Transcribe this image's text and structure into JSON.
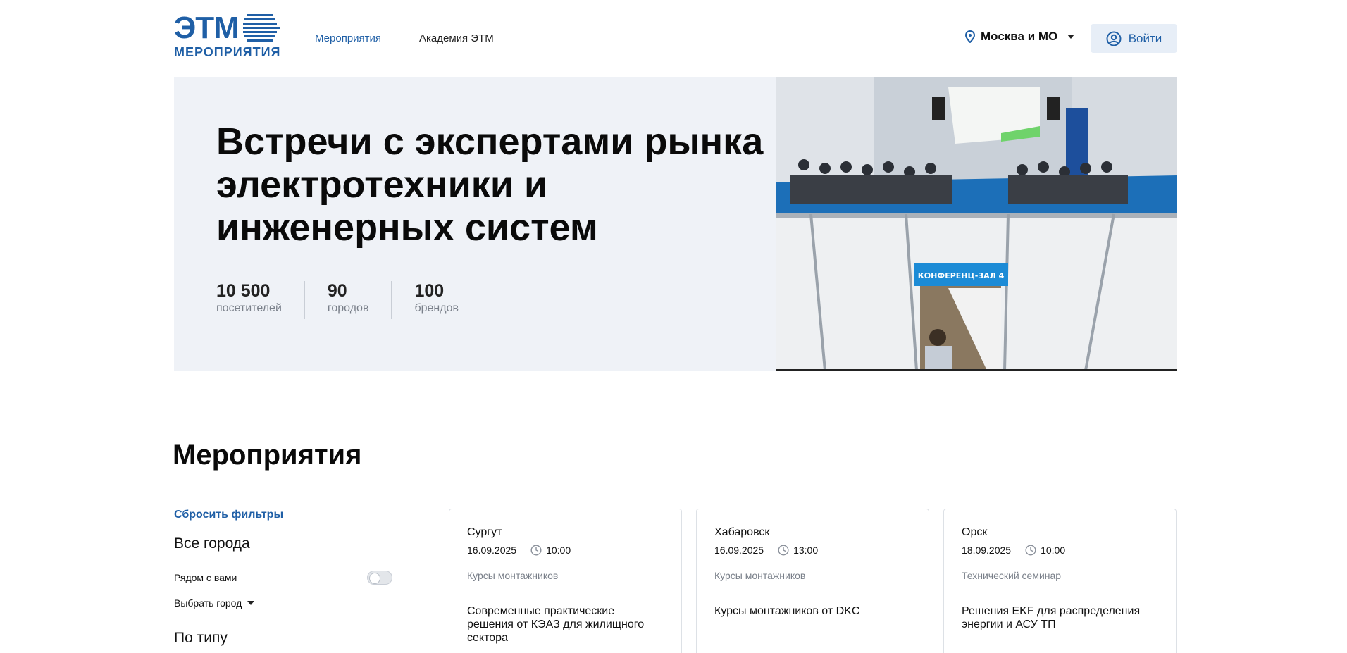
{
  "logo": {
    "brand": "ЭТМ",
    "subtitle": "МЕРОПРИЯТИЯ"
  },
  "nav": [
    {
      "label": "Мероприятия",
      "active": true
    },
    {
      "label": "Академия ЭТМ",
      "active": false
    }
  ],
  "header": {
    "city": "Москва и МО",
    "login_label": "Войти"
  },
  "hero": {
    "title": "Встречи с экспертами рынка электротехники и инженерных систем",
    "stats": [
      {
        "value": "10 500",
        "label": "посетителей"
      },
      {
        "value": "90",
        "label": "городов"
      },
      {
        "value": "100",
        "label": "брендов"
      }
    ],
    "photo_sign": "КОНФЕРЕНЦ-ЗАЛ 4"
  },
  "events": {
    "title": "Мероприятия",
    "filters": {
      "reset_label": "Сбросить фильтры",
      "cities_heading": "Все города",
      "nearby_label": "Рядом с вами",
      "select_city_label": "Выбрать город",
      "type_heading": "По типу"
    },
    "cards": [
      {
        "city": "Сургут",
        "date": "16.09.2025",
        "time": "10:00",
        "type": "Курсы монтажников",
        "title": "Современные практические решения от КЭАЗ для жилищного сектора"
      },
      {
        "city": "Хабаровск",
        "date": "16.09.2025",
        "time": "13:00",
        "type": "Курсы монтажников",
        "title": "Курсы монтажников от DKC"
      },
      {
        "city": "Орск",
        "date": "18.09.2025",
        "time": "10:00",
        "type": "Технический семинар",
        "title": "Решения EKF для распределения энергии и АСУ ТП"
      }
    ]
  },
  "colors": {
    "brand": "#1f5fa6",
    "hero_bg": "#eff2f7",
    "login_bg": "#e7eef7"
  }
}
